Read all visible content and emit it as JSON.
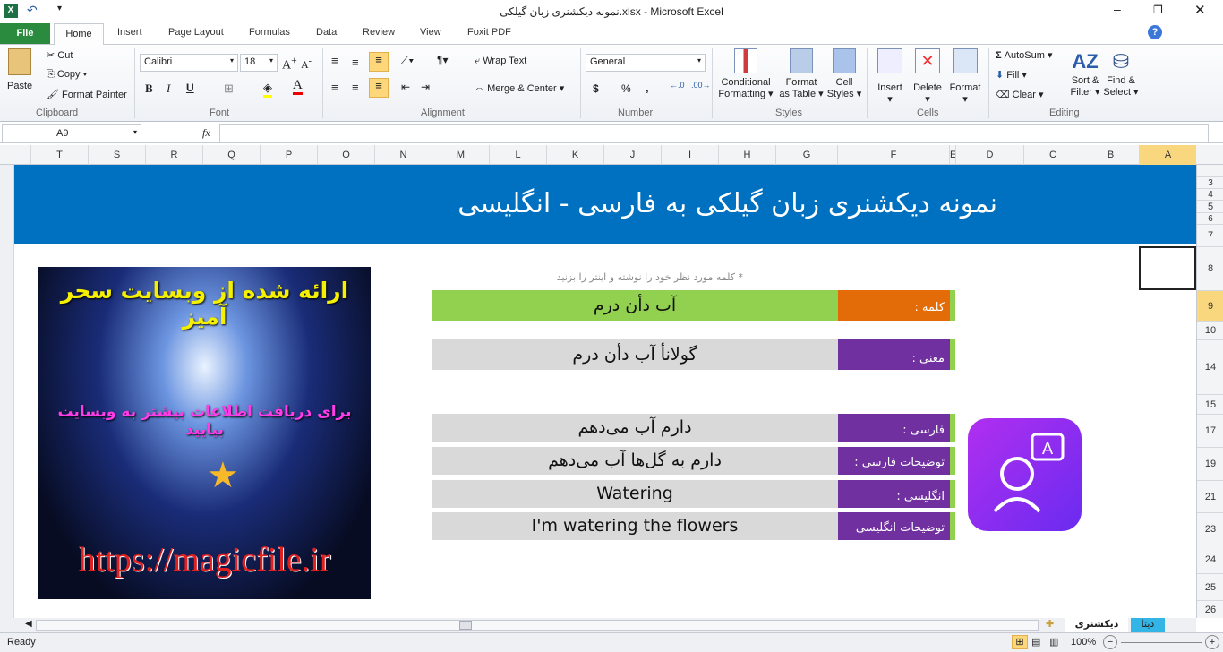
{
  "window": {
    "title": "نمونه دیکشنری زبان گیلکی.xlsx - Microsoft Excel"
  },
  "ribbon_tabs": [
    "File",
    "Home",
    "Insert",
    "Page Layout",
    "Formulas",
    "Data",
    "Review",
    "View",
    "Foxit PDF"
  ],
  "clipboard": {
    "paste": "Paste",
    "cut": "Cut",
    "copy": "Copy",
    "format_painter": "Format Painter",
    "label": "Clipboard"
  },
  "font": {
    "name": "Calibri",
    "size": "18",
    "bold": "B",
    "italic": "I",
    "underline": "U",
    "label": "Font"
  },
  "alignment": {
    "wrap": "Wrap Text",
    "merge": "Merge & Center",
    "label": "Alignment"
  },
  "number": {
    "format": "General",
    "currency": "$",
    "percent": "%",
    "comma": ",",
    "label": "Number"
  },
  "styles": {
    "conditional": [
      "Conditional",
      "Formatting"
    ],
    "table": [
      "Format",
      "as Table"
    ],
    "cell": [
      "Cell",
      "Styles"
    ],
    "label": "Styles"
  },
  "cells": {
    "insert": "Insert",
    "delete": "Delete",
    "format": "Format",
    "label": "Cells"
  },
  "editing": {
    "autosum": "AutoSum",
    "fill": "Fill",
    "clear": "Clear",
    "sort": [
      "Sort &",
      "Filter"
    ],
    "find": [
      "Find &",
      "Select"
    ],
    "label": "Editing"
  },
  "formula_bar": {
    "name_box": "A9",
    "fx": "fx",
    "value": ""
  },
  "columns": [
    "T",
    "S",
    "R",
    "Q",
    "P",
    "O",
    "N",
    "M",
    "L",
    "K",
    "J",
    "I",
    "H",
    "G",
    "F",
    "E",
    "D",
    "C",
    "B",
    "A"
  ],
  "rows": [
    "3",
    "4",
    "5",
    "6",
    "7",
    "8",
    "9",
    "10",
    "14",
    "15",
    "17",
    "19",
    "21",
    "23",
    "24",
    "25",
    "26"
  ],
  "sheet": {
    "banner": "نمونه دیکشنری زبان گیلکی به فارسی - انگلیسی",
    "hint": "* کلمه مورد نظر خود را نوشته و اینتر را بزنید",
    "word": {
      "label": "کلمه :",
      "value": "آب دأن درم"
    },
    "meaning": {
      "label": "معنی :",
      "value": "گولانأ آب دأن درم"
    },
    "persian": {
      "label": "فارسی :",
      "value": "دارم آب می‌دهم"
    },
    "persian_desc": {
      "label": "توضیحات فارسی :",
      "value": "دارم به گل‌ها آب می‌دهم"
    },
    "english": {
      "label": "انگلیسی :",
      "value": "Watering"
    },
    "english_desc": {
      "label": "توضیحات انگلیسی",
      "value": "I'm watering the flowers"
    },
    "promo": {
      "line1": "ارائه شده از وبسایت سحر آمیز",
      "line2": "برای دریافت اطلاعات بیشتر به وبسایت بیایید",
      "url": "https://magicfile.ir"
    }
  },
  "sheet_tabs": [
    "دیکشنری",
    "دیتا"
  ],
  "status": {
    "ready": "Ready",
    "zoom": "100%"
  },
  "colors": {
    "banner": "#0070c0",
    "green": "#92d050",
    "orange": "#e36c09",
    "purple": "#7030a0",
    "gray": "#d9d9d9"
  }
}
